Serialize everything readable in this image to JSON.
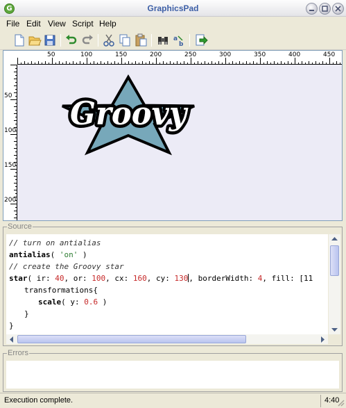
{
  "window": {
    "title": "GraphicsPad",
    "app_icon_letter": "G"
  },
  "menu": {
    "items": [
      "File",
      "Edit",
      "View",
      "Script",
      "Help"
    ]
  },
  "toolbar": {
    "buttons": [
      "new-file",
      "open-file",
      "save",
      "undo",
      "redo",
      "cut",
      "copy",
      "paste",
      "find",
      "replace",
      "run-script"
    ]
  },
  "canvas": {
    "hruler_labels": [
      "50",
      "100",
      "150",
      "200",
      "250",
      "300",
      "350",
      "400",
      "450"
    ],
    "vruler_labels": [
      "50",
      "100",
      "150",
      "200"
    ],
    "logo_text": "Groovy",
    "star_fill": "#77a8ba",
    "background": "#ecebf6"
  },
  "source": {
    "label": "Source",
    "lines": {
      "l1": "// turn on antialias",
      "l2_kw": "antialias",
      "l2_open": "( ",
      "l2_str": "'on'",
      "l2_close": " )",
      "l3": "// create the Groovy star",
      "l4_kw": "star",
      "l4_a": "( ir: ",
      "l4_ir": "40",
      "l4_b": ", or: ",
      "l4_or": "100",
      "l4_c": ", cx: ",
      "l4_cx": "160",
      "l4_d": ", cy: ",
      "l4_cy": "130",
      "l4_e": ", borderWidth: ",
      "l4_bw": "4",
      "l4_f": ", fill: [11",
      "l5": "transformations{",
      "l6_kw": "scale",
      "l6_a": "( y: ",
      "l6_y": "0.6",
      "l6_b": " )",
      "l7": "}",
      "l8": "}"
    }
  },
  "errors": {
    "label": "Errors"
  },
  "status": {
    "message": "Execution complete.",
    "position": "4:40"
  }
}
